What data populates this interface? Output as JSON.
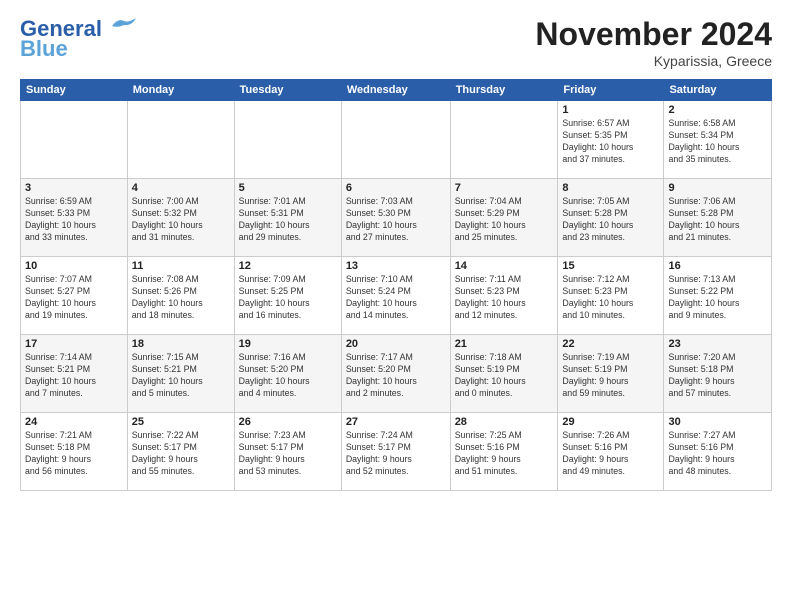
{
  "header": {
    "logo_line1": "General",
    "logo_line2": "Blue",
    "month_title": "November 2024",
    "location": "Kyparissia, Greece"
  },
  "weekdays": [
    "Sunday",
    "Monday",
    "Tuesday",
    "Wednesday",
    "Thursday",
    "Friday",
    "Saturday"
  ],
  "weeks": [
    [
      {
        "day": "",
        "info": ""
      },
      {
        "day": "",
        "info": ""
      },
      {
        "day": "",
        "info": ""
      },
      {
        "day": "",
        "info": ""
      },
      {
        "day": "",
        "info": ""
      },
      {
        "day": "1",
        "info": "Sunrise: 6:57 AM\nSunset: 5:35 PM\nDaylight: 10 hours\nand 37 minutes."
      },
      {
        "day": "2",
        "info": "Sunrise: 6:58 AM\nSunset: 5:34 PM\nDaylight: 10 hours\nand 35 minutes."
      }
    ],
    [
      {
        "day": "3",
        "info": "Sunrise: 6:59 AM\nSunset: 5:33 PM\nDaylight: 10 hours\nand 33 minutes."
      },
      {
        "day": "4",
        "info": "Sunrise: 7:00 AM\nSunset: 5:32 PM\nDaylight: 10 hours\nand 31 minutes."
      },
      {
        "day": "5",
        "info": "Sunrise: 7:01 AM\nSunset: 5:31 PM\nDaylight: 10 hours\nand 29 minutes."
      },
      {
        "day": "6",
        "info": "Sunrise: 7:03 AM\nSunset: 5:30 PM\nDaylight: 10 hours\nand 27 minutes."
      },
      {
        "day": "7",
        "info": "Sunrise: 7:04 AM\nSunset: 5:29 PM\nDaylight: 10 hours\nand 25 minutes."
      },
      {
        "day": "8",
        "info": "Sunrise: 7:05 AM\nSunset: 5:28 PM\nDaylight: 10 hours\nand 23 minutes."
      },
      {
        "day": "9",
        "info": "Sunrise: 7:06 AM\nSunset: 5:28 PM\nDaylight: 10 hours\nand 21 minutes."
      }
    ],
    [
      {
        "day": "10",
        "info": "Sunrise: 7:07 AM\nSunset: 5:27 PM\nDaylight: 10 hours\nand 19 minutes."
      },
      {
        "day": "11",
        "info": "Sunrise: 7:08 AM\nSunset: 5:26 PM\nDaylight: 10 hours\nand 18 minutes."
      },
      {
        "day": "12",
        "info": "Sunrise: 7:09 AM\nSunset: 5:25 PM\nDaylight: 10 hours\nand 16 minutes."
      },
      {
        "day": "13",
        "info": "Sunrise: 7:10 AM\nSunset: 5:24 PM\nDaylight: 10 hours\nand 14 minutes."
      },
      {
        "day": "14",
        "info": "Sunrise: 7:11 AM\nSunset: 5:23 PM\nDaylight: 10 hours\nand 12 minutes."
      },
      {
        "day": "15",
        "info": "Sunrise: 7:12 AM\nSunset: 5:23 PM\nDaylight: 10 hours\nand 10 minutes."
      },
      {
        "day": "16",
        "info": "Sunrise: 7:13 AM\nSunset: 5:22 PM\nDaylight: 10 hours\nand 9 minutes."
      }
    ],
    [
      {
        "day": "17",
        "info": "Sunrise: 7:14 AM\nSunset: 5:21 PM\nDaylight: 10 hours\nand 7 minutes."
      },
      {
        "day": "18",
        "info": "Sunrise: 7:15 AM\nSunset: 5:21 PM\nDaylight: 10 hours\nand 5 minutes."
      },
      {
        "day": "19",
        "info": "Sunrise: 7:16 AM\nSunset: 5:20 PM\nDaylight: 10 hours\nand 4 minutes."
      },
      {
        "day": "20",
        "info": "Sunrise: 7:17 AM\nSunset: 5:20 PM\nDaylight: 10 hours\nand 2 minutes."
      },
      {
        "day": "21",
        "info": "Sunrise: 7:18 AM\nSunset: 5:19 PM\nDaylight: 10 hours\nand 0 minutes."
      },
      {
        "day": "22",
        "info": "Sunrise: 7:19 AM\nSunset: 5:19 PM\nDaylight: 9 hours\nand 59 minutes."
      },
      {
        "day": "23",
        "info": "Sunrise: 7:20 AM\nSunset: 5:18 PM\nDaylight: 9 hours\nand 57 minutes."
      }
    ],
    [
      {
        "day": "24",
        "info": "Sunrise: 7:21 AM\nSunset: 5:18 PM\nDaylight: 9 hours\nand 56 minutes."
      },
      {
        "day": "25",
        "info": "Sunrise: 7:22 AM\nSunset: 5:17 PM\nDaylight: 9 hours\nand 55 minutes."
      },
      {
        "day": "26",
        "info": "Sunrise: 7:23 AM\nSunset: 5:17 PM\nDaylight: 9 hours\nand 53 minutes."
      },
      {
        "day": "27",
        "info": "Sunrise: 7:24 AM\nSunset: 5:17 PM\nDaylight: 9 hours\nand 52 minutes."
      },
      {
        "day": "28",
        "info": "Sunrise: 7:25 AM\nSunset: 5:16 PM\nDaylight: 9 hours\nand 51 minutes."
      },
      {
        "day": "29",
        "info": "Sunrise: 7:26 AM\nSunset: 5:16 PM\nDaylight: 9 hours\nand 49 minutes."
      },
      {
        "day": "30",
        "info": "Sunrise: 7:27 AM\nSunset: 5:16 PM\nDaylight: 9 hours\nand 48 minutes."
      }
    ]
  ]
}
